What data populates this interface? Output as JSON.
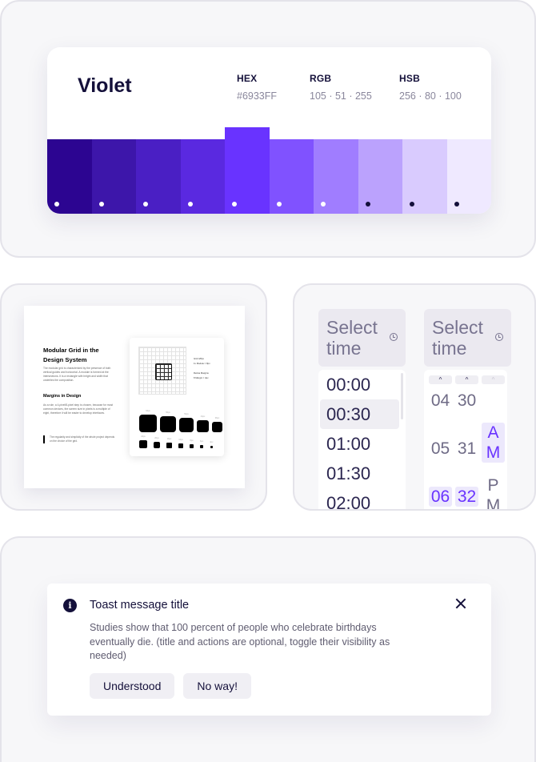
{
  "color_palette": {
    "name": "Violet",
    "specs": [
      {
        "label": "HEX",
        "value": "#6933FF"
      },
      {
        "label": "RGB",
        "value": "105 · 51 · 255"
      },
      {
        "label": "HSB",
        "value": "256 · 80 · 100"
      }
    ],
    "active_index": 4,
    "swatches": [
      {
        "color": "#2c0591",
        "dot": "#ffffff"
      },
      {
        "color": "#3d16aa",
        "dot": "#ffffff"
      },
      {
        "color": "#4a1fc4",
        "dot": "#ffffff"
      },
      {
        "color": "#5a29e0",
        "dot": "#ffffff"
      },
      {
        "color": "#6933ff",
        "dot": "#ffffff"
      },
      {
        "color": "#8052ff",
        "dot": "#ffffff"
      },
      {
        "color": "#a07dff",
        "dot": "#ffffff"
      },
      {
        "color": "#bba2fd",
        "dot": "#14103a"
      },
      {
        "color": "#d9cbfe",
        "dot": "#14103a"
      },
      {
        "color": "#efe9ff",
        "dot": "#14103a"
      }
    ]
  },
  "grid_doc": {
    "title": "Modular Grid in the Design System",
    "paragraph": "The modular grid is characterized by the presence of both vertical guides and horizontal. A module is formed at the intersections. It is a rectangle with height and width that underlies the composition.",
    "subtitle": "Margins in Design",
    "paragraph2": "As a rule, a 4-pixel/8-pixel step is chosen, because for most common devices, the screen size in pixels is a multiple of eight, therefore it will be easier to develop interfaces.",
    "quote": "The regularity and simplicity of the whole project depends on the choice of the grid.",
    "notes": [
      "Grid 4/8px",
      "1x Module = 8px",
      "Retina Margins",
      "8 Margin = 4px"
    ],
    "size_row1": [
      "64px",
      "56px",
      "52px",
      "44px",
      "36px"
    ],
    "size_row2": [
      "24px",
      "20px",
      "16px",
      "12px",
      "8px",
      "6px",
      "4px"
    ]
  },
  "time_picker": {
    "placeholder": "Select time",
    "options": [
      "00:00",
      "00:30",
      "01:00",
      "01:30",
      "02:00"
    ],
    "hovered_option": "00:30",
    "hours": [
      "04",
      "05",
      "06"
    ],
    "minutes": [
      "30",
      "31",
      "32"
    ],
    "meridiem": [
      "AM",
      "PM"
    ],
    "selected_hour": "06",
    "selected_minute": "32",
    "selected_meridiem": "AM"
  },
  "toast": {
    "icon": "info-icon",
    "title": "Toast message title",
    "body": "Studies show that 100 percent of people who celebrate birthdays eventually die. (title and actions are optional, toggle their visibility as needed)",
    "actions": [
      "Understood",
      "No way!"
    ]
  }
}
